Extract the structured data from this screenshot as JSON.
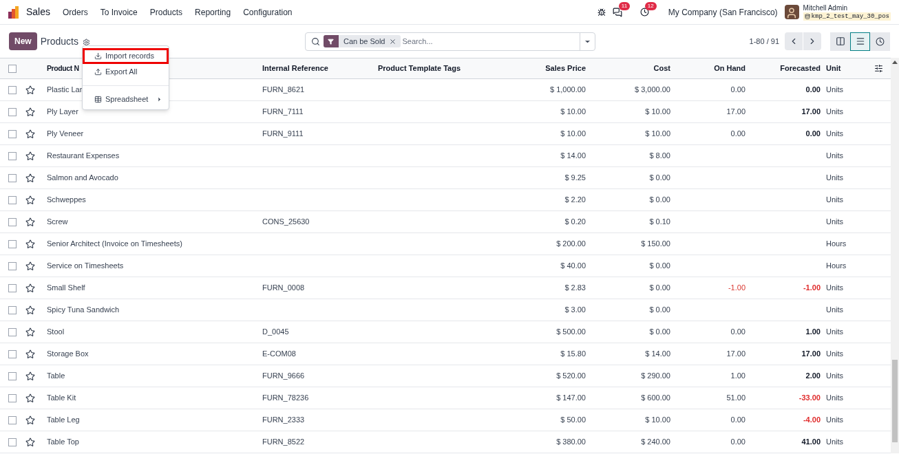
{
  "app": {
    "name": "Sales",
    "menu": [
      "Orders",
      "To Invoice",
      "Products",
      "Reporting",
      "Configuration"
    ]
  },
  "systray": {
    "messages_count": "11",
    "activities_count": "12",
    "company": "My Company (San Francisco)",
    "user": "Mitchell Admin",
    "database": "kmp_2_test_may_30_pos"
  },
  "control_panel": {
    "new_button": "New",
    "title": "Products",
    "filter_facet": "Can be Sold",
    "search_placeholder": "Search...",
    "pager": "1-80 / 91",
    "views": [
      {
        "kind": "kanban",
        "selected": false
      },
      {
        "kind": "list",
        "selected": true
      },
      {
        "kind": "activity",
        "selected": false
      }
    ]
  },
  "gear_menu": {
    "items": [
      {
        "label": "Import records",
        "kind": "import",
        "highlighted": true,
        "submenu": false
      },
      {
        "label": "Export All",
        "kind": "export",
        "highlighted": false,
        "submenu": false
      },
      {
        "label": "Spreadsheet",
        "kind": "spreadsheet",
        "highlighted": false,
        "submenu": true
      }
    ]
  },
  "table": {
    "select_all_checked": false,
    "columns": [
      "Product N",
      "Internal Reference",
      "Product Template Tags",
      "Sales Price",
      "Cost",
      "On Hand",
      "Forecasted",
      "Unit"
    ],
    "rows": [
      {
        "checked": false,
        "name": "Plastic Lar",
        "ref": "FURN_8621",
        "price": "$ 1,000.00",
        "cost": "$ 3,000.00",
        "on_hand": "0.00",
        "on_hand_negative": false,
        "forecasted": "0.00",
        "forecasted_negative": false,
        "unit": "Units"
      },
      {
        "checked": false,
        "name": "Ply Layer",
        "ref": "FURN_7111",
        "price": "$ 10.00",
        "cost": "$ 10.00",
        "on_hand": "17.00",
        "on_hand_negative": false,
        "forecasted": "17.00",
        "forecasted_negative": false,
        "unit": "Units"
      },
      {
        "checked": false,
        "name": "Ply Veneer",
        "ref": "FURN_9111",
        "price": "$ 10.00",
        "cost": "$ 10.00",
        "on_hand": "0.00",
        "on_hand_negative": false,
        "forecasted": "0.00",
        "forecasted_negative": false,
        "unit": "Units"
      },
      {
        "checked": false,
        "name": "Restaurant Expenses",
        "price": "$ 14.00",
        "cost": "$ 8.00",
        "unit": "Units"
      },
      {
        "checked": false,
        "name": "Salmon and Avocado",
        "price": "$ 9.25",
        "cost": "$ 0.00",
        "unit": "Units"
      },
      {
        "checked": false,
        "name": "Schweppes",
        "price": "$ 2.20",
        "cost": "$ 0.00",
        "unit": "Units"
      },
      {
        "checked": false,
        "name": "Screw",
        "ref": "CONS_25630",
        "price": "$ 0.20",
        "cost": "$ 0.10",
        "unit": "Units"
      },
      {
        "checked": false,
        "name": "Senior Architect (Invoice on Timesheets)",
        "price": "$ 200.00",
        "cost": "$ 150.00",
        "unit": "Hours"
      },
      {
        "checked": false,
        "name": "Service on Timesheets",
        "price": "$ 40.00",
        "cost": "$ 0.00",
        "unit": "Hours"
      },
      {
        "checked": false,
        "name": "Small Shelf",
        "ref": "FURN_0008",
        "price": "$ 2.83",
        "cost": "$ 0.00",
        "on_hand": "-1.00",
        "on_hand_negative": true,
        "forecasted": "-1.00",
        "forecasted_negative": true,
        "unit": "Units"
      },
      {
        "checked": false,
        "name": "Spicy Tuna Sandwich",
        "price": "$ 3.00",
        "cost": "$ 0.00",
        "unit": "Units"
      },
      {
        "checked": false,
        "name": "Stool",
        "ref": "D_0045",
        "price": "$ 500.00",
        "cost": "$ 0.00",
        "on_hand": "0.00",
        "on_hand_negative": false,
        "forecasted": "1.00",
        "forecasted_negative": false,
        "unit": "Units"
      },
      {
        "checked": false,
        "name": "Storage Box",
        "ref": "E-COM08",
        "price": "$ 15.80",
        "cost": "$ 14.00",
        "on_hand": "17.00",
        "on_hand_negative": false,
        "forecasted": "17.00",
        "forecasted_negative": false,
        "unit": "Units"
      },
      {
        "checked": false,
        "name": "Table",
        "ref": "FURN_9666",
        "price": "$ 520.00",
        "cost": "$ 290.00",
        "on_hand": "1.00",
        "on_hand_negative": false,
        "forecasted": "2.00",
        "forecasted_negative": false,
        "unit": "Units"
      },
      {
        "checked": false,
        "name": "Table Kit",
        "ref": "FURN_78236",
        "price": "$ 147.00",
        "cost": "$ 600.00",
        "on_hand": "51.00",
        "on_hand_negative": false,
        "forecasted": "-33.00",
        "forecasted_negative": true,
        "unit": "Units"
      },
      {
        "checked": false,
        "name": "Table Leg",
        "ref": "FURN_2333",
        "price": "$ 50.00",
        "cost": "$ 10.00",
        "on_hand": "0.00",
        "on_hand_negative": false,
        "forecasted": "-4.00",
        "forecasted_negative": true,
        "unit": "Units"
      },
      {
        "checked": false,
        "name": "Table Top",
        "ref": "FURN_8522",
        "price": "$ 380.00",
        "cost": "$ 240.00",
        "on_hand": "0.00",
        "on_hand_negative": false,
        "forecasted": "41.00",
        "forecasted_negative": false,
        "unit": "Units"
      }
    ]
  }
}
